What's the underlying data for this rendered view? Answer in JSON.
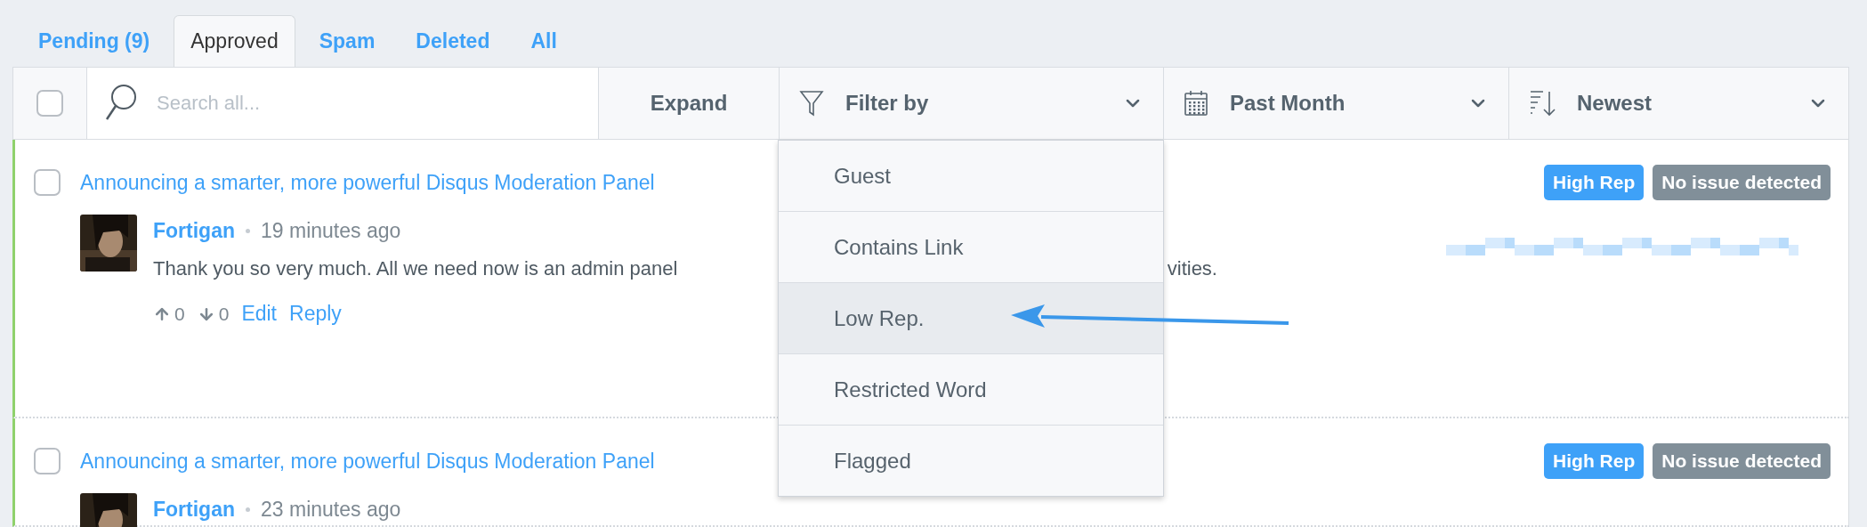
{
  "tabs": [
    {
      "label": "Pending (9)",
      "selected": false
    },
    {
      "label": "Approved",
      "selected": true
    },
    {
      "label": "Spam",
      "selected": false
    },
    {
      "label": "Deleted",
      "selected": false
    },
    {
      "label": "All",
      "selected": false
    }
  ],
  "toolbar": {
    "select_all": {
      "checked": false
    },
    "search": {
      "placeholder": "Search all..."
    },
    "expand": "Expand",
    "filter": {
      "label": "Filter by",
      "expanded": true,
      "options": [
        {
          "label": "Guest",
          "highlighted": false
        },
        {
          "label": "Contains Link",
          "highlighted": false
        },
        {
          "label": "Low Rep.",
          "highlighted": true
        },
        {
          "label": "Restricted Word",
          "highlighted": false
        },
        {
          "label": "Flagged",
          "highlighted": false
        }
      ]
    },
    "date": {
      "label": "Past Month"
    },
    "sort": {
      "label": "Newest"
    }
  },
  "comments": [
    {
      "checked": false,
      "approved": true,
      "thread_title": "Announcing a smarter, more powerful Disqus Moderation Panel",
      "author": "Fortigan",
      "time": "19 minutes ago",
      "body_start": "Thank you so very much. All we need now is an admin panel",
      "body_end": "vities.",
      "upvotes": "0",
      "downvotes": "0",
      "actions": [
        "Edit",
        "Reply"
      ],
      "badges": [
        {
          "label": "High Rep",
          "kind": "rep"
        },
        {
          "label": "No issue detected",
          "kind": "status"
        }
      ]
    },
    {
      "checked": false,
      "approved": true,
      "thread_title": "Announcing a smarter, more powerful Disqus Moderation Panel",
      "author": "Fortigan",
      "time": "23 minutes ago",
      "badges": [
        {
          "label": "High Rep",
          "kind": "rep"
        },
        {
          "label": "No issue detected",
          "kind": "status"
        }
      ]
    }
  ]
}
